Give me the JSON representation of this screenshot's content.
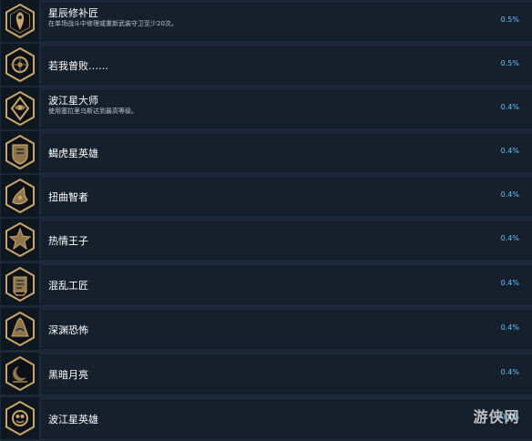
{
  "achievements": [
    {
      "title": "星辰修补匠",
      "description": "在单场战斗中修理或重新武装守卫至少20次。",
      "percent": "0.5%",
      "icon": "hexagonal-emblem-icon"
    },
    {
      "title": "若我曾败……",
      "description": "",
      "percent": "0.5%",
      "icon": "hexagonal-emblem-icon"
    },
    {
      "title": "波江星大师",
      "description": "使用塞拉里乌斯达到最高等级。",
      "percent": "0.4%",
      "icon": "hexagonal-emblem-icon"
    },
    {
      "title": "蝎虎星英雄",
      "description": "",
      "percent": "0.4%",
      "icon": "hexagonal-emblem-icon"
    },
    {
      "title": "扭曲智者",
      "description": "",
      "percent": "0.4%",
      "icon": "hexagonal-emblem-icon"
    },
    {
      "title": "热情王子",
      "description": "",
      "percent": "0.4%",
      "icon": "hexagonal-emblem-icon"
    },
    {
      "title": "混乱工匠",
      "description": "",
      "percent": "0.4%",
      "icon": "hexagonal-emblem-icon"
    },
    {
      "title": "深渊恐怖",
      "description": "",
      "percent": "0.4%",
      "icon": "hexagonal-emblem-icon"
    },
    {
      "title": "黑暗月亮",
      "description": "",
      "percent": "0.4%",
      "icon": "hexagonal-emblem-icon"
    },
    {
      "title": "波江星英雄",
      "description": "",
      "percent": "0.4%",
      "icon": "hexagonal-emblem-icon"
    }
  ],
  "watermark": {
    "text": "游侠网"
  },
  "colors": {
    "background": "#1b2838",
    "panel": "#16202d",
    "icon_background": "#0f1720",
    "gold": "#c9a768",
    "percent": "#66c0f4"
  }
}
